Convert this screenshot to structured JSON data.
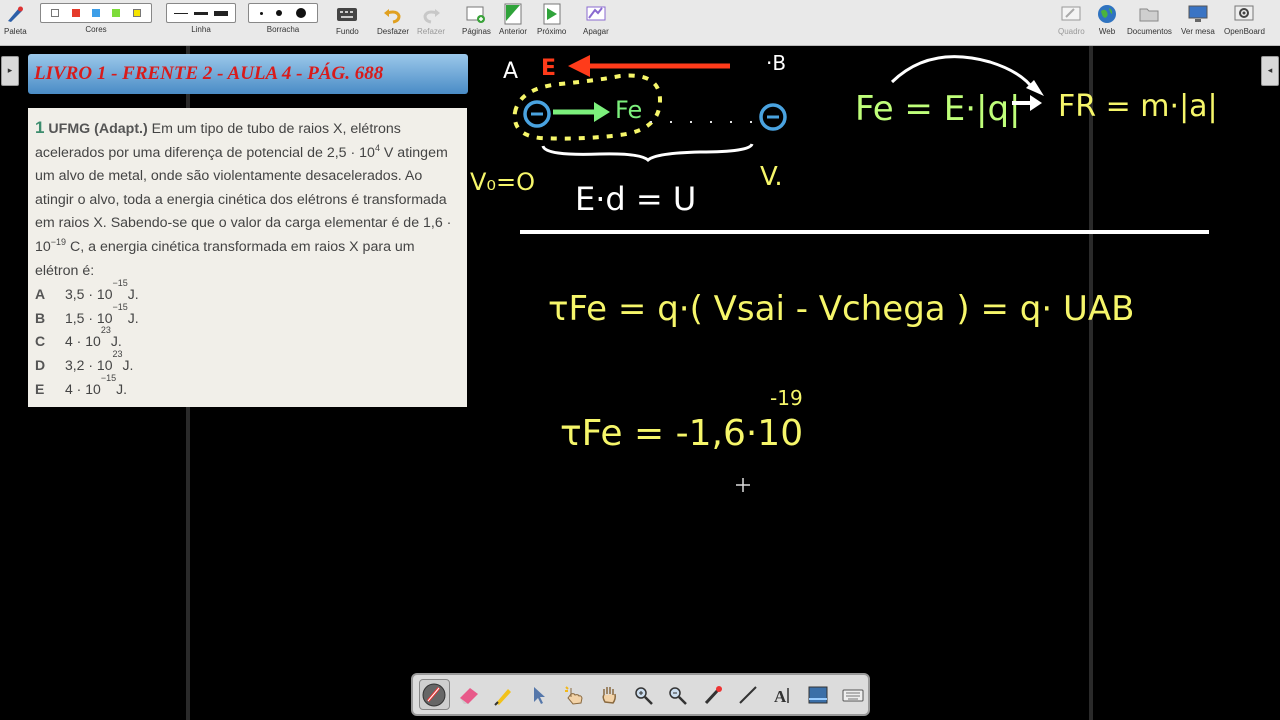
{
  "toolbar": {
    "palette_label": "Paleta",
    "colors_label": "Cores",
    "line_label": "Linha",
    "eraser_label": "Borracha",
    "background_label": "Fundo",
    "undo_label": "Desfazer",
    "redo_label": "Refazer",
    "pages_label": "Páginas",
    "previous_label": "Anterior",
    "next_label": "Próximo",
    "delete_label": "Apagar",
    "board_label": "Quadro",
    "web_label": "Web",
    "documents_label": "Documentos",
    "desktop_label": "Ver mesa",
    "openboard_label": "OpenBoard",
    "colors": [
      "#ffffff",
      "#e53b2b",
      "#3d9ee8",
      "#7ddc3a",
      "#f5e400"
    ]
  },
  "banner": {
    "title": "LIVRO 1 - FRENTE 2 - AULA 4 - PÁG. 688"
  },
  "question": {
    "number": "1",
    "source": "UFMG (Adapt.)",
    "text_before_exp": " Em um tipo de tubo de raios X, elétrons acelerados por uma diferença de potencial de 2,5 · 10",
    "exp1": "4",
    "text_after_exp": " V atingem um alvo de metal, onde são violentamente desacelerados. Ao atingir o alvo, toda a energia cinética dos elétrons é transformada em raios X. Sabendo-se que o valor da carga elementar é de 1,6 · 10",
    "exp2": "−19",
    "text_end": " C, a energia cinética transformada em raios X para um elétron é:",
    "options": [
      {
        "letter": "A",
        "base": "3,5 · 10",
        "exp": "−15",
        "unit": " J."
      },
      {
        "letter": "B",
        "base": "1,5 · 10",
        "exp": "−15",
        "unit": " J."
      },
      {
        "letter": "C",
        "base": "4 · 10",
        "exp": "23",
        "unit": " J."
      },
      {
        "letter": "D",
        "base": "3,2 · 10",
        "exp": "23",
        "unit": " J."
      },
      {
        "letter": "E",
        "base": "4 · 10",
        "exp": "−15",
        "unit": " J."
      }
    ]
  },
  "handwriting": {
    "point_a": "A",
    "field_e": "E",
    "point_b": "·B",
    "force_fe": "Fe",
    "v0": "V₀=O",
    "v": "V.",
    "ed_u": "E·d = U",
    "fe_formula": "Fe = E·|q|",
    "fr_formula": "FR = m·|a|",
    "work_eq": "τFe = q·( Vsai - Vchega ) = q· UAB",
    "work_value": "τFe = -1,6·10",
    "work_exp": "-19"
  },
  "ink_colors": {
    "white": "#ffffff",
    "red": "#ff3b1a",
    "green": "#7cf07c",
    "yellow": "#f6f66a",
    "blue": "#4aa3e0",
    "lime": "#bfff7a"
  }
}
